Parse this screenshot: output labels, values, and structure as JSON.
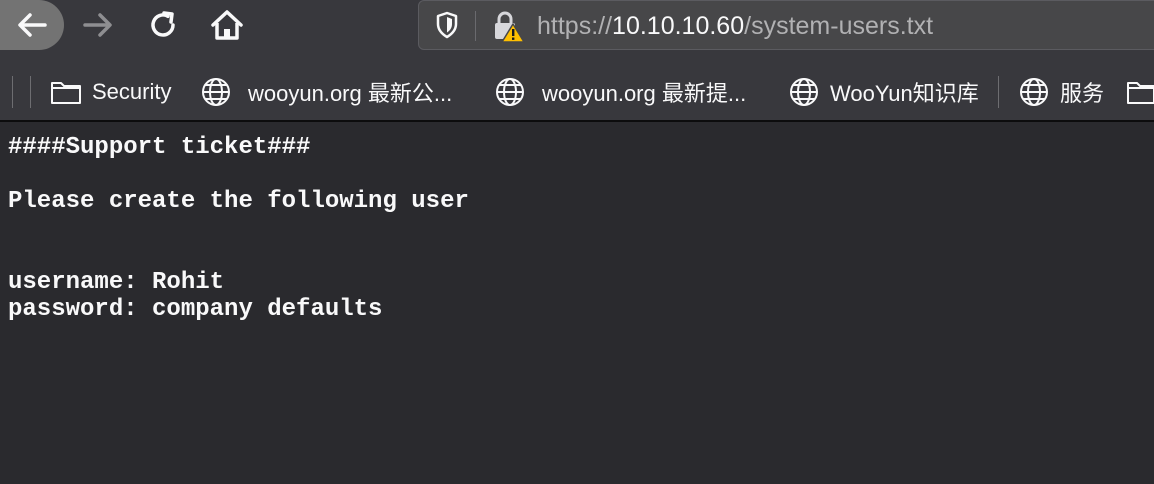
{
  "browser": {
    "nav": {
      "back_icon": "arrow-left-icon",
      "forward_icon": "arrow-right-icon",
      "reload_icon": "reload-icon",
      "home_icon": "home-icon"
    },
    "urlbar": {
      "tracking_icon": "shield-icon",
      "security_icon": "insecure-lock-warning-icon",
      "url_scheme": "https://",
      "url_host": "10.10.10.60",
      "url_path": "/system-users.txt"
    },
    "bookmarks": [
      {
        "label": "Security",
        "icon": "folder-icon"
      },
      {
        "label": "wooyun.org 最新公...",
        "icon": "globe-icon"
      },
      {
        "label": "wooyun.org 最新提...",
        "icon": "globe-icon"
      },
      {
        "label": "WooYun知识库",
        "icon": "globe-icon"
      },
      {
        "label": "服务",
        "icon": "globe-icon"
      },
      {
        "label": "",
        "icon": "folder-icon"
      }
    ]
  },
  "document": {
    "lines": [
      "####Support ticket###",
      "",
      "Please create the following user",
      "",
      "",
      "username: Rohit",
      "password: company defaults"
    ]
  },
  "colors": {
    "toolbar_bg": "#38383d",
    "urlbar_bg": "#474749",
    "page_bg": "#2a2a2e",
    "text": "#f9f9fa",
    "url_dim": "#b1b1b3",
    "warning": "#ffbf00"
  }
}
